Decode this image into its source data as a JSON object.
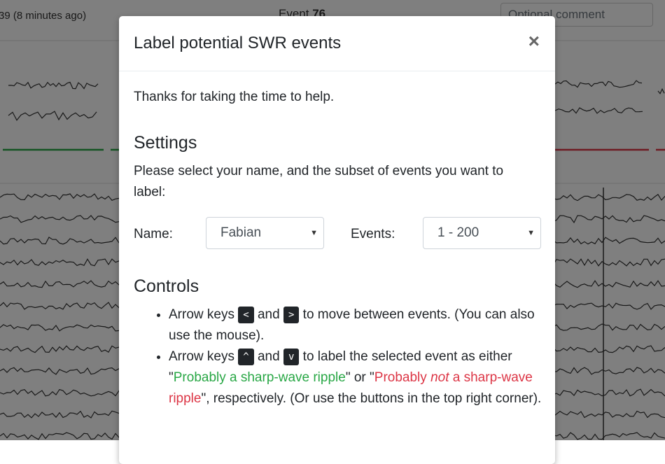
{
  "background": {
    "top_left": "39 (8 minutes ago)",
    "event_prefix": "Event",
    "event_number": "76",
    "comment_placeholder": "Optional comment"
  },
  "modal": {
    "title": "Label potential SWR events",
    "close": "×",
    "intro": "Thanks for taking the time to help.",
    "settings": {
      "heading": "Settings",
      "text": "Please select your name, and the subset of events you want to label:",
      "name_label": "Name:",
      "name_value": "Fabian",
      "events_label": "Events:",
      "events_value": "1 - 200",
      "caret": "▼"
    },
    "controls": {
      "heading": "Controls",
      "item1": {
        "pre": "Arrow keys",
        "key1": "<",
        "mid": "and",
        "key2": ">",
        "post": "to move between events. (You can also use the mouse)."
      },
      "item2": {
        "pre": "Arrow keys",
        "key1": "^",
        "mid": "and",
        "key2": "v",
        "post": "to label the selected event as either",
        "q_open": "\"",
        "green_label": "Probably a sharp-wave ripple",
        "q_mid": "\" or \"",
        "red_pre": "Probably",
        "red_em": "not",
        "red_post": "a sharp-wave ripple",
        "tail": "\", respectively. (Or use the buttons in the top right corner)."
      }
    }
  },
  "colors": {
    "green_bar": "#28a745",
    "red_bar": "#dc3545"
  }
}
